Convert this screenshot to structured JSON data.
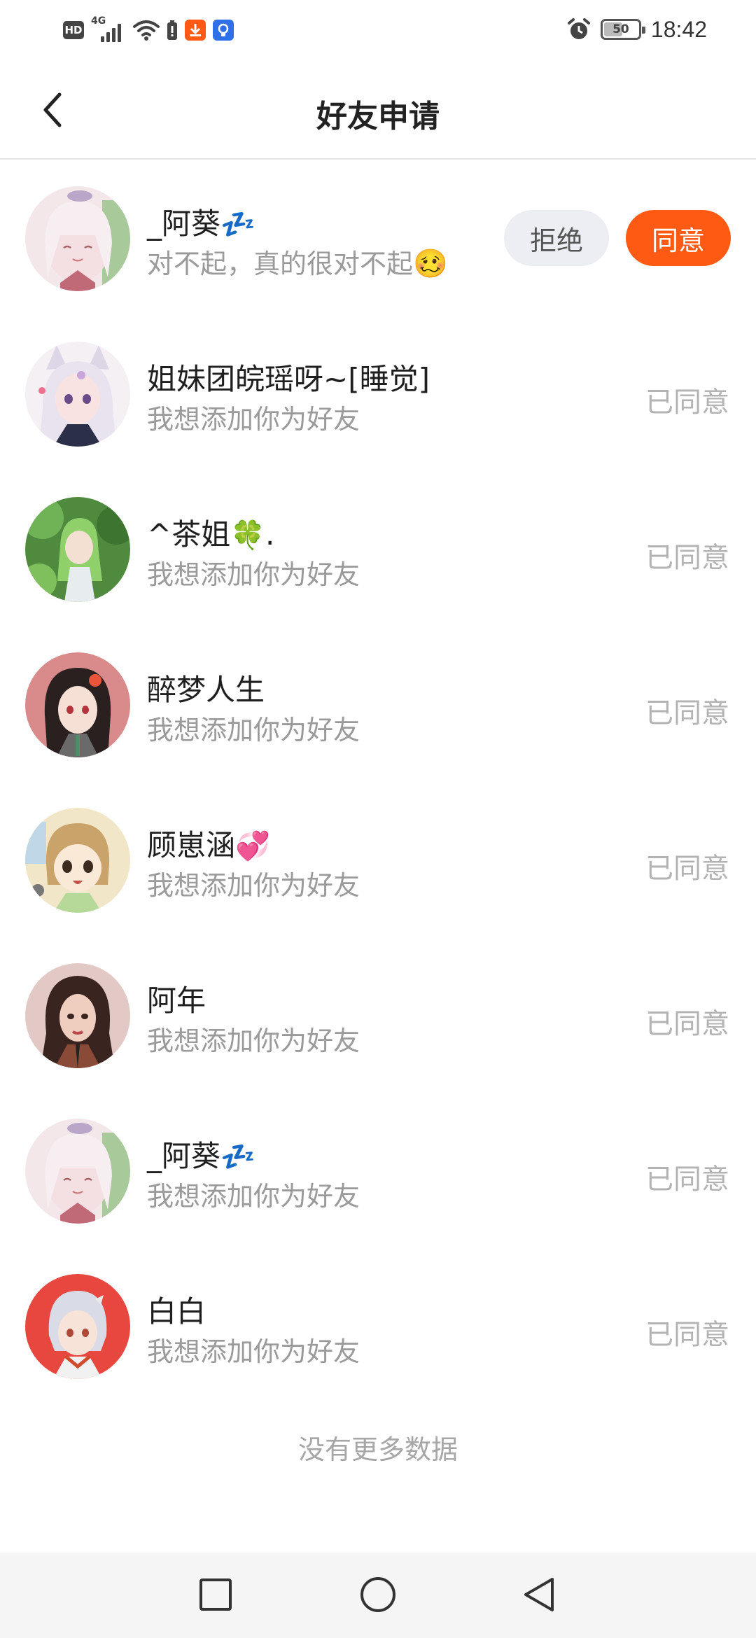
{
  "status_bar": {
    "hd_label": "HD",
    "network_label": "4G",
    "battery_level": "50",
    "time": "18:42",
    "icons": [
      "hd-icon",
      "signal-icon",
      "wifi-icon",
      "battery-saver-icon",
      "download-app-icon",
      "bulb-app-icon",
      "alarm-icon",
      "battery-icon"
    ]
  },
  "header": {
    "title": "好友申请",
    "back_icon": "chevron-left-icon"
  },
  "requests": [
    {
      "name": "_阿葵",
      "emoji": "💤",
      "message": "对不起，真的很对不起",
      "message_emoji": "🥴",
      "reject_label": "拒绝",
      "accept_label": "同意"
    },
    {
      "name": "姐妹团皖瑶呀~[睡觉]",
      "emoji": "",
      "message": "我想添加你为好友",
      "status": "已同意"
    },
    {
      "name": "^茶姐",
      "emoji": "🍀",
      "suffix": ".",
      "message": "我想添加你为好友",
      "status": "已同意"
    },
    {
      "name": "醉梦人生",
      "emoji": "",
      "message": "我想添加你为好友",
      "status": "已同意"
    },
    {
      "name": "顾崽涵",
      "emoji": "💞",
      "message": "我想添加你为好友",
      "status": "已同意"
    },
    {
      "name": "阿年",
      "emoji": "",
      "message": "我想添加你为好友",
      "status": "已同意"
    },
    {
      "name": "_阿葵",
      "emoji": "💤",
      "message": "我想添加你为好友",
      "status": "已同意"
    },
    {
      "name": "白白",
      "emoji": "",
      "message": "我想添加你为好友",
      "status": "已同意"
    }
  ],
  "footer": {
    "no_more_text": "没有更多数据"
  },
  "system_nav": {
    "buttons": [
      "recent-apps-square-icon",
      "home-circle-icon",
      "back-triangle-icon"
    ]
  },
  "colors": {
    "accent": "#ff5a14",
    "reject_bg": "#eceef3",
    "secondary_text": "#9a9a9a",
    "status_text": "#b3b3b3"
  }
}
